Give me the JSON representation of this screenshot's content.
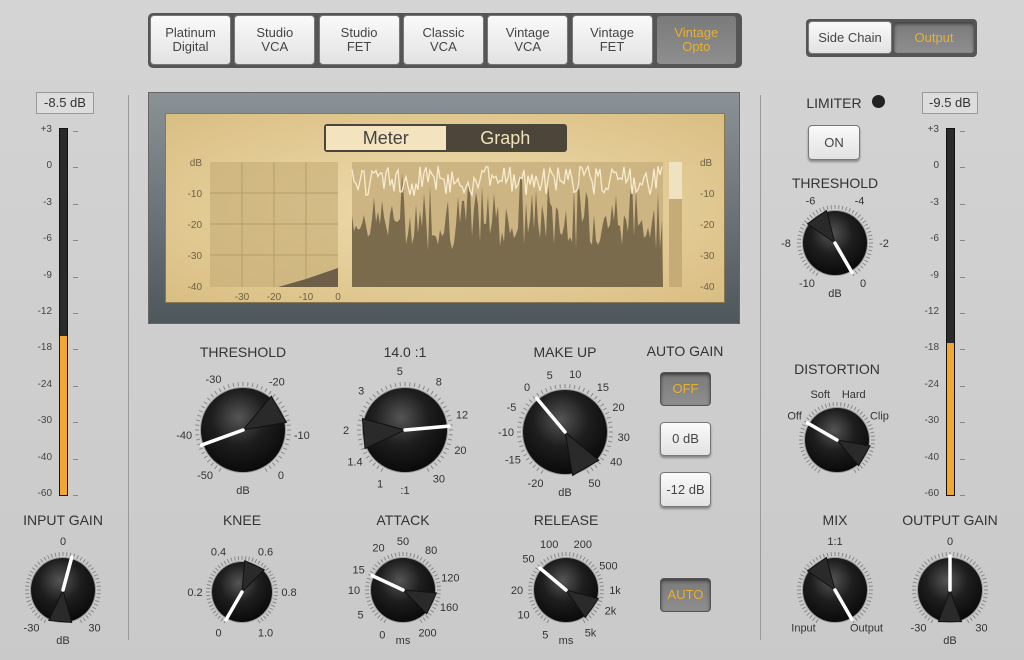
{
  "modes": [
    {
      "label1": "Platinum",
      "label2": "Digital"
    },
    {
      "label1": "Studio",
      "label2": "VCA"
    },
    {
      "label1": "Studio",
      "label2": "FET"
    },
    {
      "label1": "Classic",
      "label2": "VCA"
    },
    {
      "label1": "Vintage",
      "label2": "VCA"
    },
    {
      "label1": "Vintage",
      "label2": "FET"
    },
    {
      "label1": "Vintage",
      "label2": "Opto",
      "selected": true
    }
  ],
  "routing": {
    "side_chain": "Side Chain",
    "output": "Output",
    "selected": "Output"
  },
  "accent": "#f0a830",
  "input_meter": {
    "readout": "-8.5 dB",
    "level_db": -16
  },
  "output_meter": {
    "readout": "-9.5 dB",
    "level_db": -17
  },
  "meter_scale": [
    "+3",
    "0",
    "-3",
    "-6",
    "-9",
    "-12",
    "-18",
    "-24",
    "-30",
    "-40",
    "-60"
  ],
  "display": {
    "meter_tab": "Meter",
    "graph_tab": "Graph",
    "selected": "Graph",
    "left_y": [
      "dB",
      "-10",
      "-20",
      "-30",
      "-40"
    ],
    "left_x": [
      "-30",
      "-20",
      "-10",
      "0"
    ],
    "right_y": [
      "dB",
      "-10",
      "-20",
      "-30",
      "-40"
    ]
  },
  "knobs": {
    "threshold": {
      "title": "THRESHOLD",
      "unit": "dB",
      "scale": [
        "-50",
        "-40",
        "-30",
        "-20",
        "-10",
        "0"
      ]
    },
    "ratio": {
      "title": "14.0 :1",
      "unit": ":1",
      "scale": [
        "1",
        "1.4",
        "2",
        "3",
        "5",
        "8",
        "12",
        "20",
        "30"
      ]
    },
    "makeup": {
      "title": "MAKE UP",
      "unit": "dB",
      "scale": [
        "-20",
        "-15",
        "-10",
        "-5",
        "0",
        "5",
        "10",
        "15",
        "20",
        "30",
        "40",
        "50"
      ]
    },
    "knee": {
      "title": "KNEE",
      "unit": "",
      "scale": [
        "0",
        "0.2",
        "0.4",
        "0.6",
        "0.8",
        "1.0"
      ]
    },
    "attack": {
      "title": "ATTACK",
      "unit": "ms",
      "scale": [
        "0",
        "5",
        "10",
        "15",
        "20",
        "50",
        "80",
        "120",
        "160",
        "200"
      ]
    },
    "release": {
      "title": "RELEASE",
      "unit": "ms",
      "scale": [
        "5",
        "10",
        "20",
        "50",
        "100",
        "200",
        "500",
        "1k",
        "2k",
        "5k"
      ]
    },
    "input_gain": {
      "title": "INPUT GAIN",
      "unit": "dB",
      "scale": [
        "-30",
        "0",
        "30"
      ]
    },
    "limiter_threshold": {
      "title": "THRESHOLD",
      "unit": "dB",
      "scale": [
        "-10",
        "-8",
        "-6",
        "-4",
        "-2",
        "0"
      ]
    },
    "distortion": {
      "title": "DISTORTION",
      "unit": "",
      "scale": [
        "Off",
        "Soft",
        "Hard",
        "Clip"
      ]
    },
    "mix": {
      "title": "MIX",
      "unit": "",
      "scale": [
        "Input",
        "1:1",
        "Output"
      ]
    },
    "output_gain": {
      "title": "OUTPUT GAIN",
      "unit": "dB",
      "scale": [
        "-30",
        "0",
        "30"
      ]
    }
  },
  "auto_gain": {
    "title": "AUTO GAIN",
    "off": "OFF",
    "zero": "0 dB",
    "minus12": "-12 dB",
    "selected": "OFF"
  },
  "auto_button": "AUTO",
  "limiter": {
    "title": "LIMITER",
    "on_label": "ON"
  }
}
